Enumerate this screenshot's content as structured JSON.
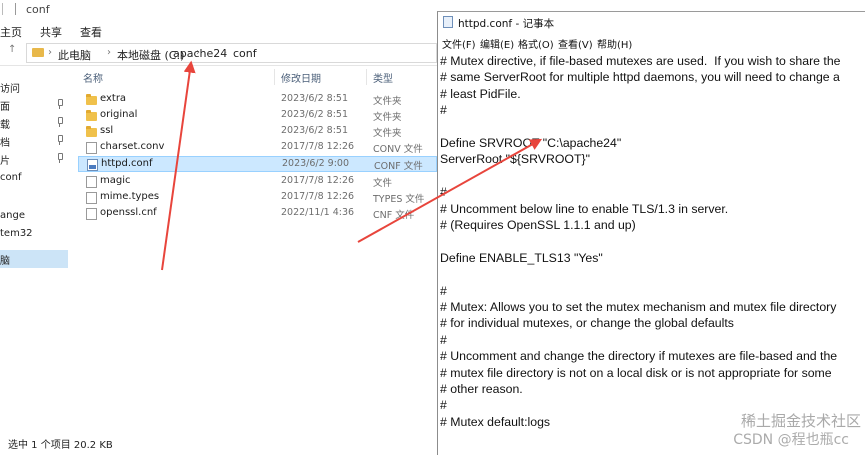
{
  "explorer": {
    "title": "conf",
    "ribbon": [
      "主页",
      "共享",
      "查看"
    ],
    "breadcrumb": [
      "此电脑",
      "本地磁盘 (C:)",
      "apache24",
      "conf"
    ],
    "nav_items": [
      "访问",
      "面",
      "载",
      "档",
      "片",
      "conf",
      "ange",
      "tem32",
      "脑"
    ],
    "columns": [
      "名称",
      "修改日期",
      "类型"
    ],
    "files": [
      {
        "name": "extra",
        "date": "2023/6/2 8:51",
        "type": "文件夹",
        "icon": "folder"
      },
      {
        "name": "original",
        "date": "2023/6/2 8:51",
        "type": "文件夹",
        "icon": "folder"
      },
      {
        "name": "ssl",
        "date": "2023/6/2 8:51",
        "type": "文件夹",
        "icon": "folder"
      },
      {
        "name": "charset.conv",
        "date": "2017/7/8 12:26",
        "type": "CONV 文件",
        "icon": "file"
      },
      {
        "name": "httpd.conf",
        "date": "2023/6/2 9:00",
        "type": "CONF 文件",
        "icon": "conf-file"
      },
      {
        "name": "magic",
        "date": "2017/7/8 12:26",
        "type": "文件",
        "icon": "file"
      },
      {
        "name": "mime.types",
        "date": "2017/7/8 12:26",
        "type": "TYPES 文件",
        "icon": "file"
      },
      {
        "name": "openssl.cnf",
        "date": "2022/11/1 4:36",
        "type": "CNF 文件",
        "icon": "file"
      }
    ],
    "status": "选中 1 个项目  20.2 KB"
  },
  "notepad": {
    "title": "httpd.conf - 记事本",
    "menu": [
      "文件(F)",
      "编辑(E)",
      "格式(O)",
      "查看(V)",
      "帮助(H)"
    ],
    "lines": [
      "# Mutex directive, if file-based mutexes are used.  If you wish to share the",
      "# same ServerRoot for multiple httpd daemons, you will need to change a",
      "# least PidFile.",
      "#",
      "",
      "Define SRVROOT \"C:\\apache24\"",
      "ServerRoot \"${SRVROOT}\"",
      "",
      "#",
      "# Uncomment below line to enable TLS/1.3 in server.",
      "# (Requires OpenSSL 1.1.1 and up)",
      "",
      "Define ENABLE_TLS13 \"Yes\"",
      "",
      "#",
      "# Mutex: Allows you to set the mutex mechanism and mutex file directory",
      "# for individual mutexes, or change the global defaults",
      "#",
      "# Uncomment and change the directory if mutexes are file-based and the",
      "# mutex file directory is not on a local disk or is not appropriate for some",
      "# other reason.",
      "#",
      "# Mutex default:logs"
    ]
  },
  "watermark": {
    "line1": "稀土掘金技术社区",
    "line2": "CSDN @程也瓶cc"
  },
  "colors": {
    "arrow": "#e8453c",
    "selection": "#cce8ff",
    "folder": "#f0c14b"
  }
}
